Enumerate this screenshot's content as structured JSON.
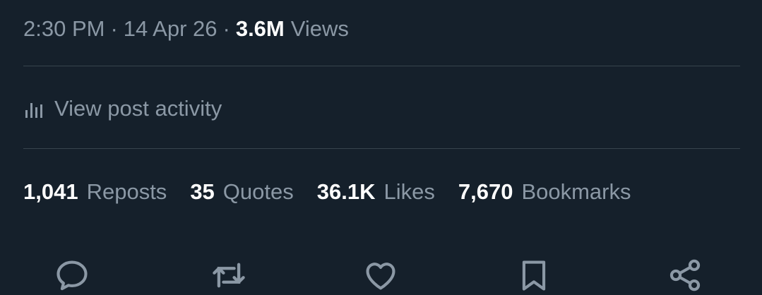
{
  "post_meta": {
    "time": "2:30 PM",
    "separator": "·",
    "date": "14 Apr 26",
    "views_count": "3.6M",
    "views_label": "Views"
  },
  "activity": {
    "icon": "bar-chart-icon",
    "label": "View post activity"
  },
  "stats": [
    {
      "count": "1,041",
      "label": "Reposts"
    },
    {
      "count": "35",
      "label": "Quotes"
    },
    {
      "count": "36.1K",
      "label": "Likes"
    },
    {
      "count": "7,670",
      "label": "Bookmarks"
    }
  ],
  "actions": [
    {
      "icon": "reply-icon"
    },
    {
      "icon": "repost-icon"
    },
    {
      "icon": "like-icon"
    },
    {
      "icon": "bookmark-icon"
    },
    {
      "icon": "share-icon"
    }
  ],
  "colors": {
    "background": "#15202b",
    "muted_text": "#8b98a5",
    "strong_text": "#ffffff",
    "divider": "#38444d"
  }
}
